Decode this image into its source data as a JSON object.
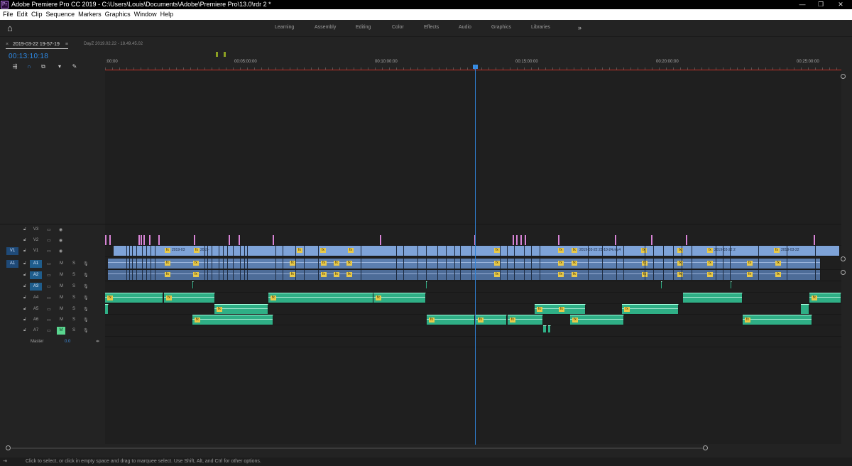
{
  "window": {
    "title": "Adobe Premiere Pro CC 2019 - C:\\Users\\Louis\\Documents\\Adobe\\Premiere Pro\\13.0\\rdr 2 *",
    "app_icon": "Pr",
    "controls": {
      "minimize": "—",
      "restore": "❐",
      "close": "✕"
    }
  },
  "menubar": [
    "File",
    "Edit",
    "Clip",
    "Sequence",
    "Markers",
    "Graphics",
    "Window",
    "Help"
  ],
  "workspaces": [
    "Learning",
    "Assembly",
    "Editing",
    "Color",
    "Effects",
    "Audio",
    "Graphics",
    "Libraries",
    "»"
  ],
  "sequence_tabs": {
    "active": "2019-03-22 19-57-19",
    "active_menu": "≡",
    "close": "×",
    "other": "DayZ 2019.02.22 - 18.49.45.02"
  },
  "timecode": "00:13:10:18",
  "ruler_labels": [
    ":00:00",
    "00:05:00:00",
    "00:10:00:00",
    "00:15:00:00",
    "00:20:00:00",
    "00:25:00:00"
  ],
  "tracks": {
    "video": [
      {
        "name": "V3"
      },
      {
        "name": "V2"
      },
      {
        "name": "V1",
        "source": "V1",
        "selected": true
      }
    ],
    "audio": [
      {
        "name": "A1",
        "source": "A1",
        "selected": true
      },
      {
        "name": "A2",
        "selected": true
      },
      {
        "name": "A3",
        "selected": true
      },
      {
        "name": "A4"
      },
      {
        "name": "A5"
      },
      {
        "name": "A6"
      },
      {
        "name": "A7",
        "mute_on": true
      }
    ],
    "mute_label": "M",
    "solo_label": "S",
    "master": {
      "label": "Master",
      "value": "0.0"
    }
  },
  "clip_labels": {
    "v1a": "2019-03",
    "v1b": "2019-",
    "v1c": "2019-03-22 23-10-24.mp4",
    "v1d": "2019-03-22 2",
    "v1e": "2019-03-22",
    "fx": "fx"
  },
  "status": "Click to select, or click in empty space and drag to marquee select. Use Shift, Alt, and Ctrl for other options.",
  "colors": {
    "timecode": "#2d8ceb",
    "video_clip": "#7ea3d8",
    "audio_clip": "#5c7fb0",
    "green_clip": "#2faf86",
    "playhead": "#2f82d6",
    "work_area": "#c4291f"
  }
}
